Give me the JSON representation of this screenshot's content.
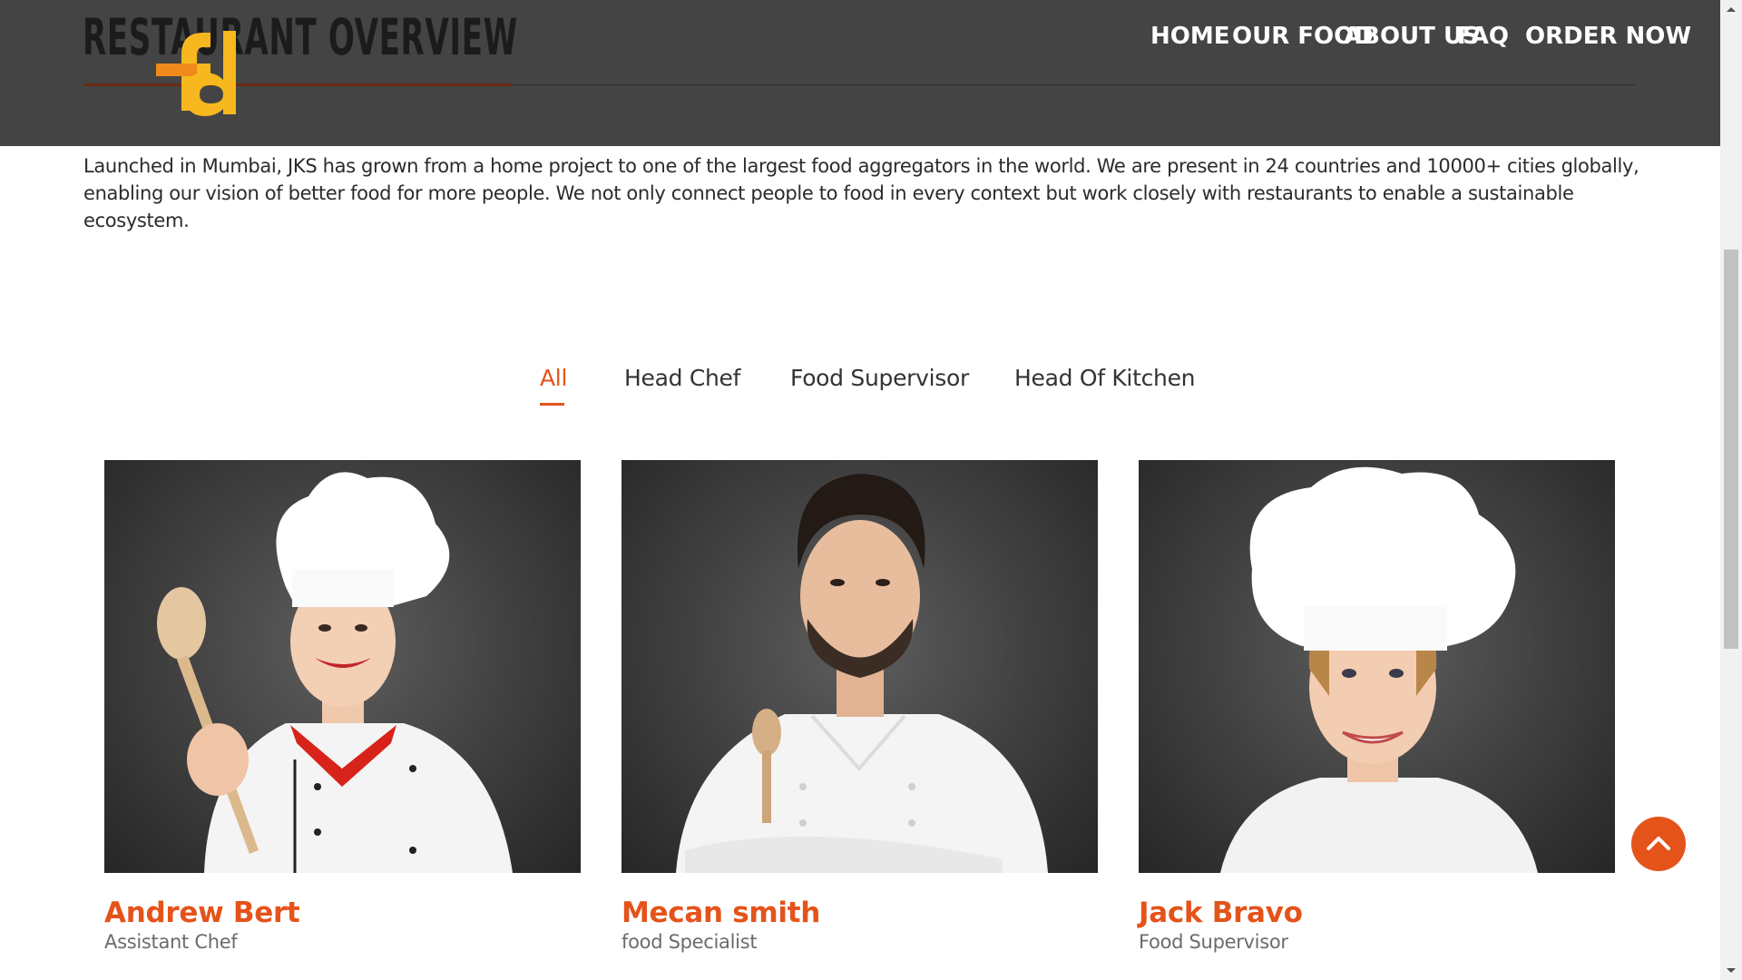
{
  "header": {
    "section_title": "RESTAURANT OVERVIEW",
    "logo_text": "fd",
    "nav": [
      {
        "label": "HOME"
      },
      {
        "label": "OUR FOOD"
      },
      {
        "label": "ABOUT US"
      },
      {
        "label": "FAQ"
      },
      {
        "label": "ORDER NOW"
      }
    ]
  },
  "intro": {
    "text": "Launched in Mumbai, JKS has grown from a home project to one of the largest food aggregators in the world. We are present in 24 countries and 10000+ cities globally, enabling our vision of better food for more people. We not only connect people to food in every context but work closely with restaurants to enable a sustainable ecosystem."
  },
  "filters": {
    "active": "All",
    "tabs": [
      {
        "label": "All"
      },
      {
        "label": "Head Chef"
      },
      {
        "label": "Food Supervisor"
      },
      {
        "label": "Head Of Kitchen"
      }
    ]
  },
  "team": [
    {
      "name": "Andrew Bert",
      "role": "Assistant Chef"
    },
    {
      "name": "Mecan smith",
      "role": "food Specialist"
    },
    {
      "name": "Jack Bravo",
      "role": "Food Supervisor"
    }
  ],
  "colors": {
    "accent": "#e4531a",
    "header_bg": "#444444",
    "logo_yellow": "#f6b81e",
    "logo_orange": "#f08a1c"
  },
  "icons": {
    "scroll_top": "chevron-up-icon"
  }
}
